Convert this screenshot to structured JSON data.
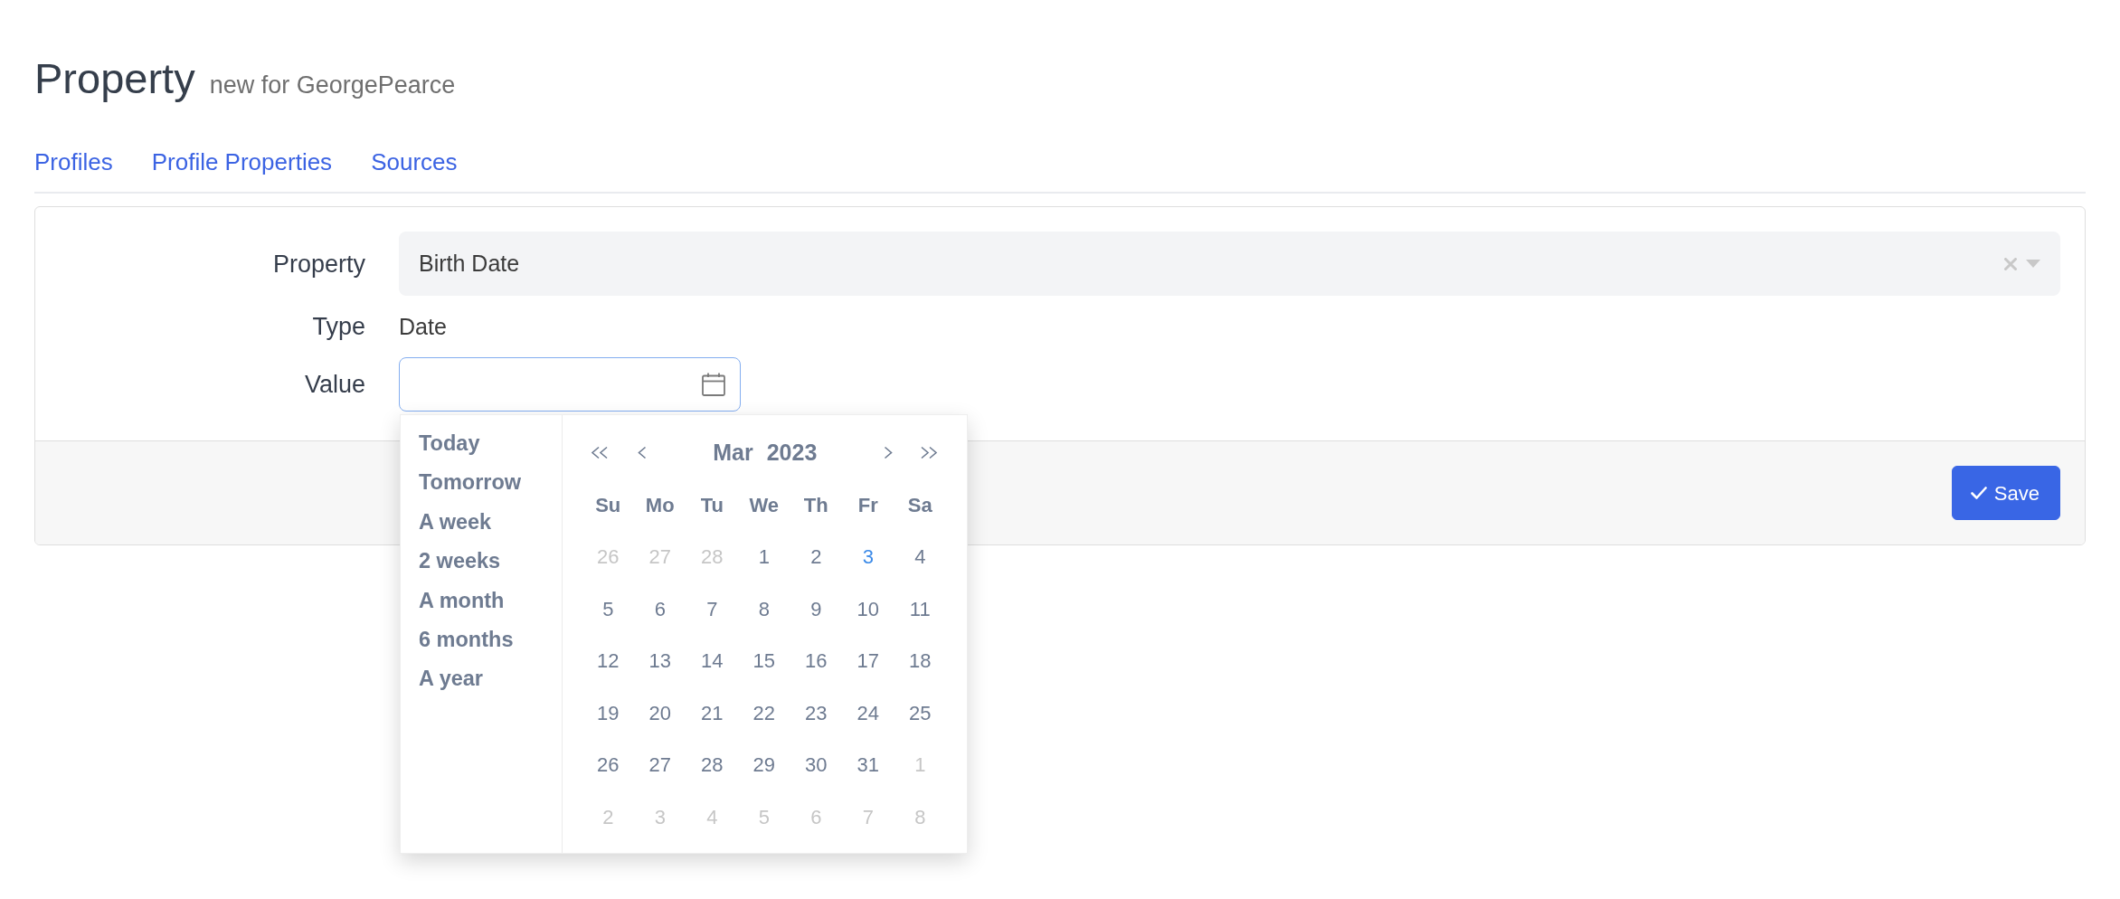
{
  "header": {
    "title": "Property",
    "subtitle": "new for GeorgePearce"
  },
  "tabs": [
    {
      "label": "Profiles"
    },
    {
      "label": "Profile Properties"
    },
    {
      "label": "Sources"
    }
  ],
  "form": {
    "fields": [
      {
        "kind": "select",
        "label": "Property",
        "value": "Birth Date",
        "clearable": true
      },
      {
        "kind": "static",
        "label": "Type",
        "value": "Date"
      },
      {
        "kind": "date",
        "label": "Value",
        "focused": true,
        "picker": {
          "shortcuts": [
            "Today",
            "Tomorrow",
            "A week",
            "2 weeks",
            "A month",
            "6 months",
            "A year"
          ],
          "month": "Mar",
          "year": "2023",
          "weekdays": [
            "Su",
            "Mo",
            "Tu",
            "We",
            "Th",
            "Fr",
            "Sa"
          ],
          "weeks": [
            [
              {
                "day": "26",
                "outside": true,
                "today": false
              },
              {
                "day": "27",
                "outside": true,
                "today": false
              },
              {
                "day": "28",
                "outside": true,
                "today": false
              },
              {
                "day": "1",
                "outside": false,
                "today": false
              },
              {
                "day": "2",
                "outside": false,
                "today": false
              },
              {
                "day": "3",
                "outside": false,
                "today": true
              },
              {
                "day": "4",
                "outside": false,
                "today": false
              }
            ],
            [
              {
                "day": "5",
                "outside": false,
                "today": false
              },
              {
                "day": "6",
                "outside": false,
                "today": false
              },
              {
                "day": "7",
                "outside": false,
                "today": false
              },
              {
                "day": "8",
                "outside": false,
                "today": false
              },
              {
                "day": "9",
                "outside": false,
                "today": false
              },
              {
                "day": "10",
                "outside": false,
                "today": false
              },
              {
                "day": "11",
                "outside": false,
                "today": false
              }
            ],
            [
              {
                "day": "12",
                "outside": false,
                "today": false
              },
              {
                "day": "13",
                "outside": false,
                "today": false
              },
              {
                "day": "14",
                "outside": false,
                "today": false
              },
              {
                "day": "15",
                "outside": false,
                "today": false
              },
              {
                "day": "16",
                "outside": false,
                "today": false
              },
              {
                "day": "17",
                "outside": false,
                "today": false
              },
              {
                "day": "18",
                "outside": false,
                "today": false
              }
            ],
            [
              {
                "day": "19",
                "outside": false,
                "today": false
              },
              {
                "day": "20",
                "outside": false,
                "today": false
              },
              {
                "day": "21",
                "outside": false,
                "today": false
              },
              {
                "day": "22",
                "outside": false,
                "today": false
              },
              {
                "day": "23",
                "outside": false,
                "today": false
              },
              {
                "day": "24",
                "outside": false,
                "today": false
              },
              {
                "day": "25",
                "outside": false,
                "today": false
              }
            ],
            [
              {
                "day": "26",
                "outside": false,
                "today": false
              },
              {
                "day": "27",
                "outside": false,
                "today": false
              },
              {
                "day": "28",
                "outside": false,
                "today": false
              },
              {
                "day": "29",
                "outside": false,
                "today": false
              },
              {
                "day": "30",
                "outside": false,
                "today": false
              },
              {
                "day": "31",
                "outside": false,
                "today": false
              },
              {
                "day": "1",
                "outside": true,
                "today": false
              }
            ],
            [
              {
                "day": "2",
                "outside": true,
                "today": false
              },
              {
                "day": "3",
                "outside": true,
                "today": false
              },
              {
                "day": "4",
                "outside": true,
                "today": false
              },
              {
                "day": "5",
                "outside": true,
                "today": false
              },
              {
                "day": "6",
                "outside": true,
                "today": false
              },
              {
                "day": "7",
                "outside": true,
                "today": false
              },
              {
                "day": "8",
                "outside": true,
                "today": false
              }
            ]
          ]
        }
      }
    ]
  },
  "footer": {
    "buttons": [
      {
        "label": "Save",
        "kind": "primary"
      }
    ]
  }
}
